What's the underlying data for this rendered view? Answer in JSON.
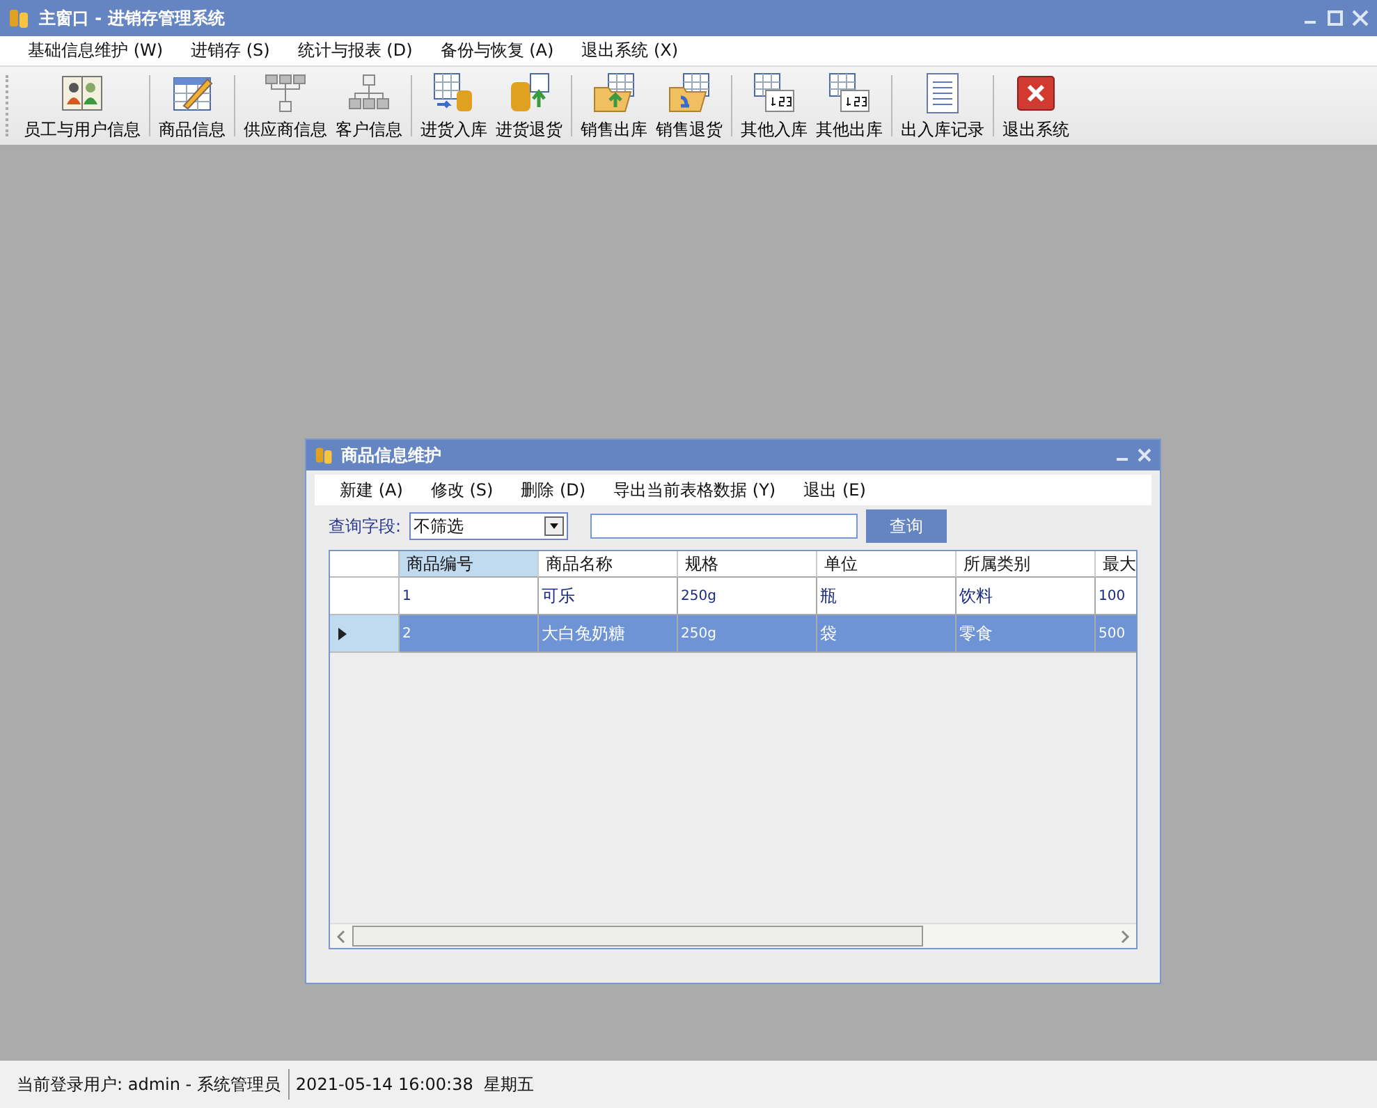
{
  "window": {
    "title": "主窗口 - 进销存管理系统"
  },
  "menu": [
    "基础信息维护 (W)",
    "进销存 (S)",
    "统计与报表 (D)",
    "备份与恢复 (A)",
    "退出系统 (X)"
  ],
  "toolbar": [
    {
      "items": [
        "员工与用户信息"
      ]
    },
    {
      "items": [
        "商品信息"
      ]
    },
    {
      "items": [
        "供应商信息",
        "客户信息"
      ]
    },
    {
      "items": [
        "进货入库",
        "进货退货"
      ]
    },
    {
      "items": [
        "销售出库",
        "销售退货"
      ]
    },
    {
      "items": [
        "其他入库",
        "其他出库"
      ]
    },
    {
      "items": [
        "出入库记录"
      ]
    },
    {
      "items": [
        "退出系统"
      ]
    }
  ],
  "child_window": {
    "title": "商品信息维护",
    "menu": [
      "新建 (A)",
      "修改 (S)",
      "删除 (D)",
      "导出当前表格数据 (Y)",
      "退出 (E)"
    ],
    "query_label": "查询字段:",
    "filter_value": "不筛选",
    "search_button": "查询",
    "table": {
      "columns": [
        {
          "label": "商品编号",
          "selected": true
        },
        {
          "label": "商品名称",
          "selected": false
        },
        {
          "label": "规格",
          "selected": false
        },
        {
          "label": "单位",
          "selected": false
        },
        {
          "label": "所属类别",
          "selected": false
        },
        {
          "label": "最大",
          "selected": false
        }
      ],
      "rows": [
        {
          "cells": [
            "1",
            "可乐",
            "250g",
            "瓶",
            "饮料",
            "100"
          ],
          "selected": false
        },
        {
          "cells": [
            "2",
            "大白兔奶糖",
            "250g",
            "袋",
            "零食",
            "500"
          ],
          "selected": true
        }
      ]
    }
  },
  "status_bar": [
    "当前登录用户: admin - 系统管理员",
    "2021-05-14 16:00:38  星期五"
  ]
}
